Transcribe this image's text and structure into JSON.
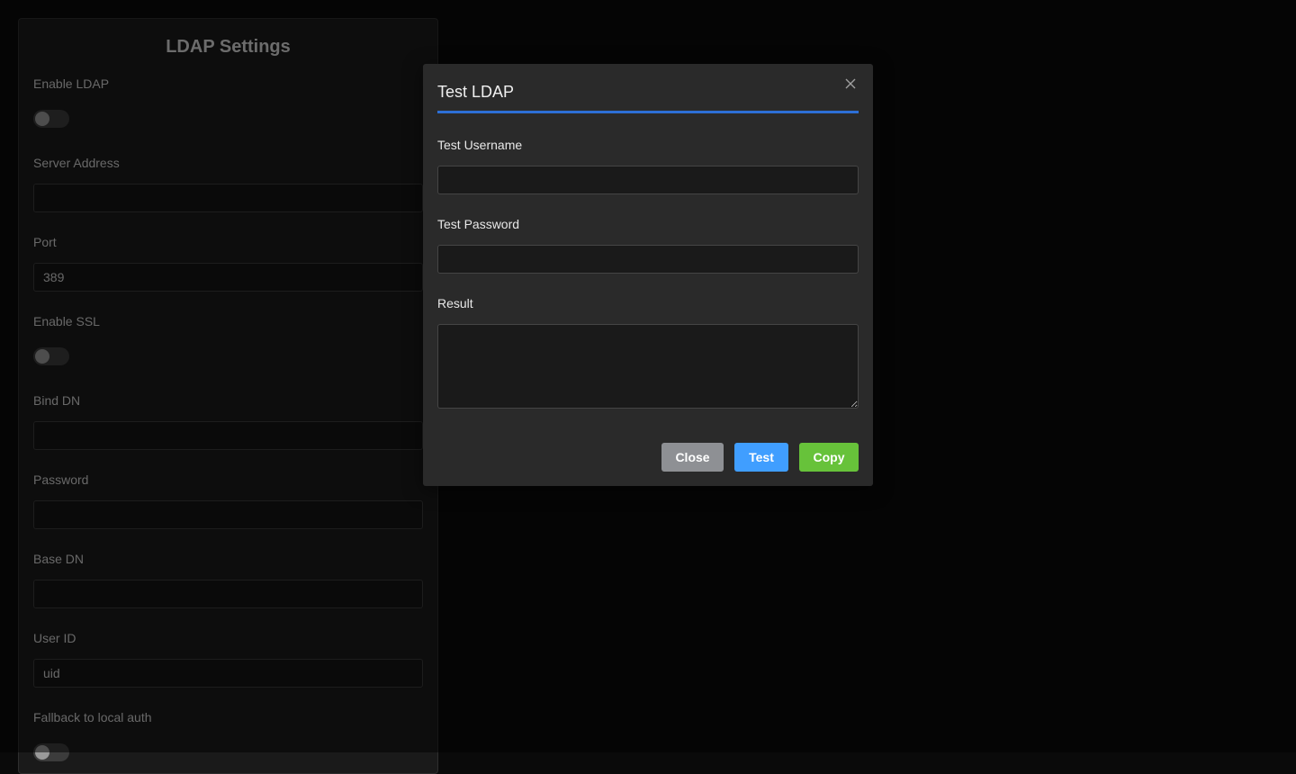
{
  "settings": {
    "title": "LDAP Settings",
    "enable_ldap_label": "Enable LDAP",
    "enable_ldap": false,
    "server_address_label": "Server Address",
    "server_address_value": "",
    "port_label": "Port",
    "port_value": "389",
    "enable_ssl_label": "Enable SSL",
    "enable_ssl": false,
    "bind_dn_label": "Bind DN",
    "bind_dn_value": "",
    "password_label": "Password",
    "password_value": "",
    "base_dn_label": "Base DN",
    "base_dn_value": "",
    "user_id_label": "User ID",
    "user_id_value": "uid",
    "fallback_label": "Fallback to local auth",
    "fallback": false
  },
  "modal": {
    "title": "Test LDAP",
    "close_icon": "close-icon",
    "username_label": "Test Username",
    "username_value": "",
    "password_label": "Test Password",
    "password_value": "",
    "result_label": "Result",
    "result_value": "",
    "close_button": "Close",
    "test_button": "Test",
    "copy_button": "Copy"
  },
  "colors": {
    "accent": "#2d6fd6",
    "test_button": "#409eff",
    "copy_button": "#67c23a",
    "close_button": "#8e9094"
  }
}
